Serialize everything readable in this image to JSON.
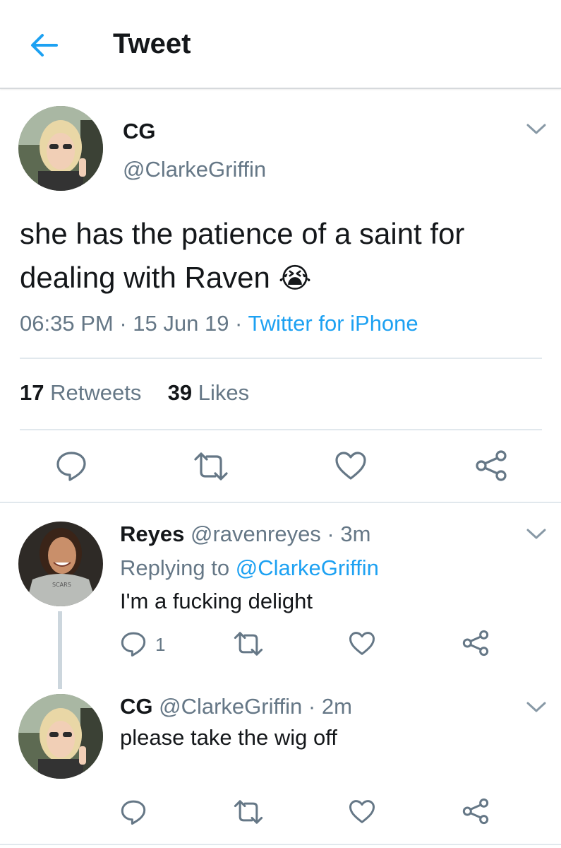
{
  "header": {
    "title": "Tweet"
  },
  "main_tweet": {
    "display_name": "CG",
    "handle": "@ClarkeGriffin",
    "text": "she has the patience of a saint for dealing with Raven",
    "emoji": "😭",
    "time": "06:35 PM",
    "sep1": " · ",
    "date": "15 Jun 19",
    "sep2": " · ",
    "source": "Twitter for iPhone",
    "retweet_count": "17",
    "retweet_label": "Retweets",
    "like_count": "39",
    "like_label": "Likes"
  },
  "replies": [
    {
      "display_name": "Reyes",
      "handle": "@ravenreyes",
      "time": "3m",
      "replying_prefix": "Replying to ",
      "replying_to": "@ClarkeGriffin",
      "text": "I'm a fucking delight",
      "reply_count": "1"
    },
    {
      "display_name": "CG",
      "handle": "@ClarkeGriffin",
      "time": "2m",
      "text": "please take the wig off"
    }
  ],
  "colors": {
    "accent": "#1da1f2",
    "muted": "#657786",
    "divider": "#e1e8ed",
    "text": "#14171a"
  },
  "icons": [
    "back-arrow-icon",
    "chevron-down-icon",
    "reply-icon",
    "retweet-icon",
    "like-icon",
    "share-icon"
  ]
}
